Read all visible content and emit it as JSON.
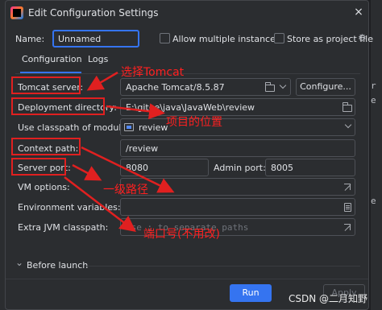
{
  "window": {
    "title": "Edit Configuration Settings",
    "close_glyph": "×"
  },
  "background": {
    "right_fragments": [
      "r",
      "e",
      "e"
    ]
  },
  "header": {
    "name_label": "Name:",
    "name_value": "Unnamed",
    "allow_multiple_label": "Allow multiple instances",
    "store_as_file_label": "Store as project file",
    "gear_glyph": "⚙"
  },
  "tabs": [
    {
      "label": "Configuration",
      "selected": true
    },
    {
      "label": "Logs",
      "selected": false
    }
  ],
  "form": {
    "tomcat_server": {
      "label": "Tomcat server:",
      "value": "Apache Tomcat/8.5.87",
      "configure_label": "Configure..."
    },
    "deployment_directory": {
      "label": "Deployment directory:",
      "value": "E:\\gitee\\java\\JavaWeb\\review"
    },
    "classpath_module": {
      "label": "Use classpath of module:",
      "value": "review"
    },
    "context_path": {
      "label": "Context path:",
      "value": "/review"
    },
    "server_port": {
      "label": "Server port:",
      "value": "8080",
      "admin_label": "Admin port:",
      "admin_value": "8005"
    },
    "vm_options": {
      "label": "VM options:",
      "value": ""
    },
    "env_variables": {
      "label": "Environment variables:",
      "value": ""
    },
    "extra_classpath": {
      "label": "Extra JVM classpath:",
      "placeholder": "Use ; to separate paths"
    }
  },
  "before_launch": {
    "label": "Before launch",
    "chevron_glyph": "⌄"
  },
  "footer": {
    "run_label": "Run",
    "apply_label": "Apply"
  },
  "annotations": {
    "select_tomcat": "选择Tomcat",
    "project_location": "项目的位置",
    "first_level_path": "一级路径",
    "port_unchanged": "端口号(不用改)"
  },
  "watermark": "CSDN @二月知野",
  "colors": {
    "accent": "#3574f0",
    "annotation_red": "#ff2020",
    "dialog_bg": "#2b2d30"
  }
}
